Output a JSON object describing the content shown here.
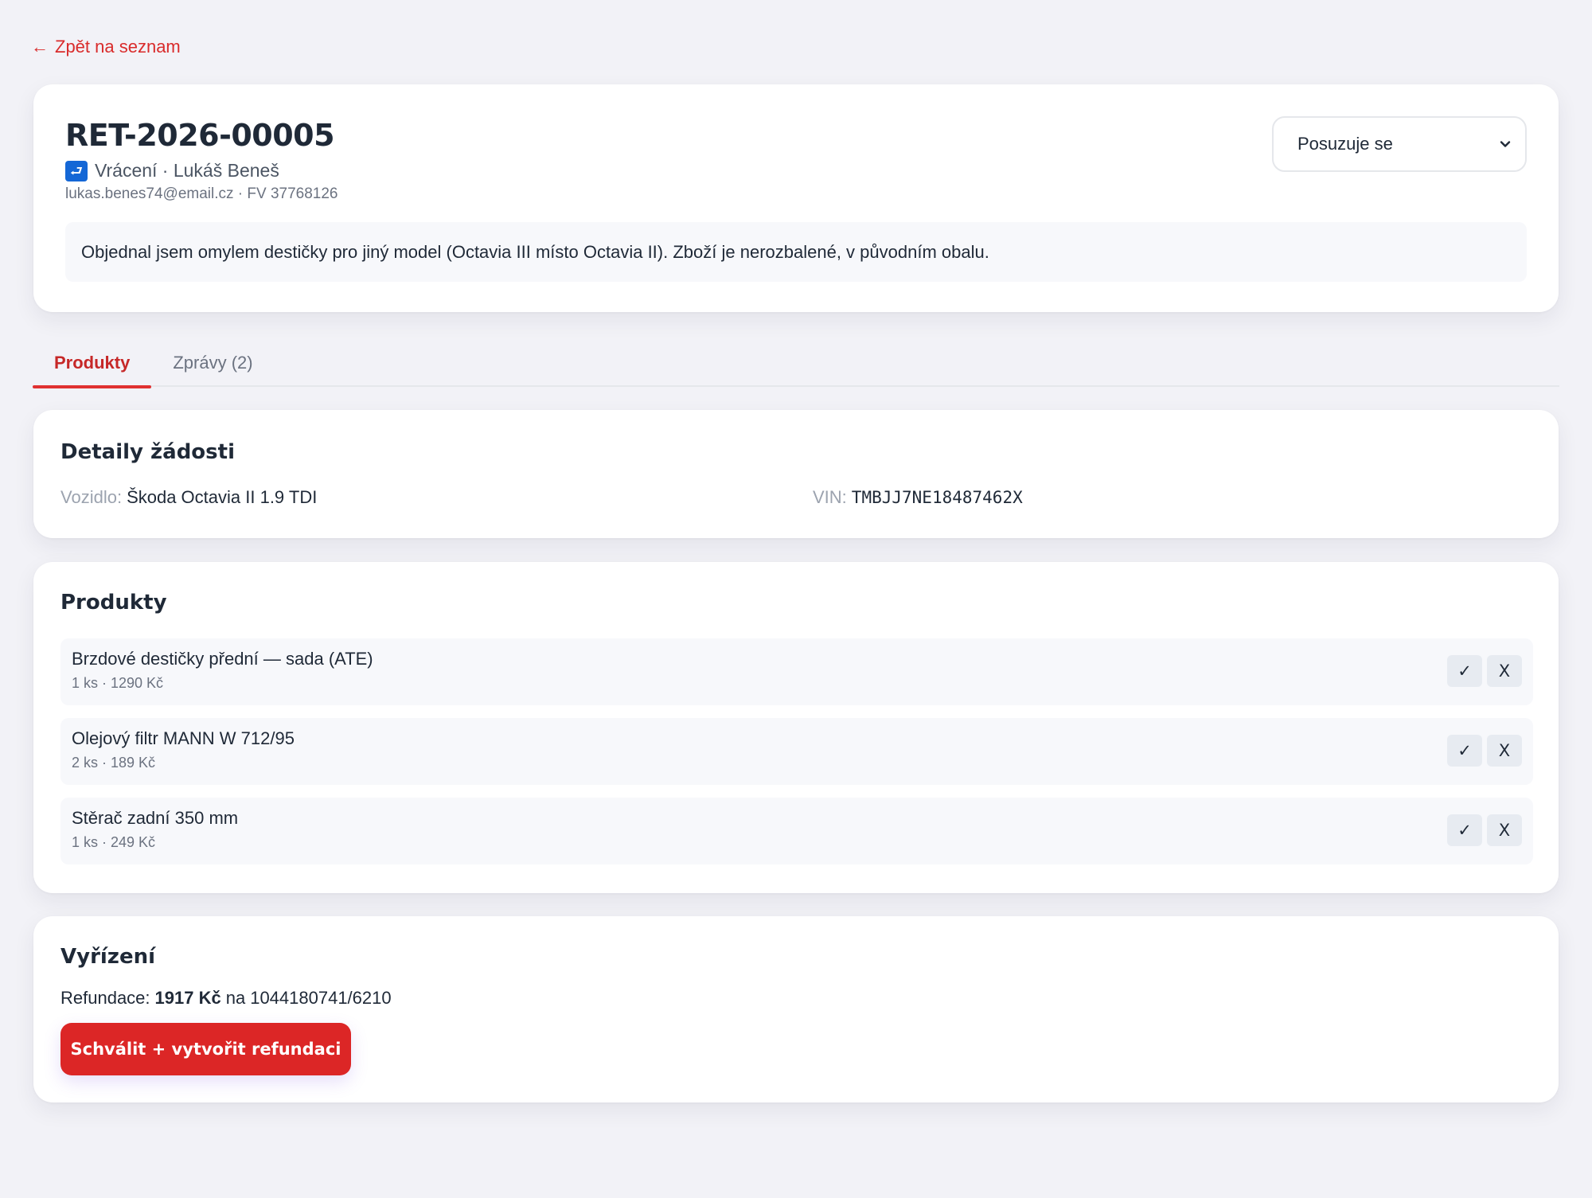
{
  "back_link": {
    "arrow": "←",
    "label": "Zpět na seznam"
  },
  "header": {
    "ticket_id": "RET-2026-00005",
    "type_icon": "return-arrow-icon",
    "type_icon_glyph": "⮐",
    "subtitle": "Vrácení · Lukáš Beneš",
    "meta": "lukas.benes74@email.cz · FV 37768126",
    "status": {
      "selected": "Posuzuje se"
    },
    "reason": "Objednal jsem omylem destičky pro jiný model (Octavia III místo Octavia II). Zboží je nerozbalené, v původním obalu."
  },
  "tabs": [
    {
      "label": "Produkty",
      "active": true
    },
    {
      "label": "Zprávy (2)",
      "active": false
    }
  ],
  "details": {
    "title": "Detaily žádosti",
    "vehicle_label": "Vozidlo:",
    "vehicle_value": "Škoda Octavia II 1.9 TDI",
    "vin_label": "VIN:",
    "vin_value": "TMBJJ7NE18487462X"
  },
  "products": {
    "title": "Produkty",
    "items": [
      {
        "name": "Brzdové destičky přední — sada (ATE)",
        "meta": "1 ks · 1290 Kč",
        "approve": "✓",
        "reject": "X"
      },
      {
        "name": "Olejový filtr MANN W 712/95",
        "meta": "2 ks · 189 Kč",
        "approve": "✓",
        "reject": "X"
      },
      {
        "name": "Stěrač zadní 350 mm",
        "meta": "1 ks · 249 Kč",
        "approve": "✓",
        "reject": "X"
      }
    ]
  },
  "resolution": {
    "title": "Vyřízení",
    "refund_label": "Refundace:",
    "refund_amount": "1917 Kč",
    "refund_connector": "na",
    "refund_account": "1044180741/6210",
    "approve_button": "Schválit + vytvořit refundaci"
  },
  "colors": {
    "accent": "#dc2626",
    "background": "#f2f2f7",
    "card": "#ffffff",
    "badge": "#1467d6"
  }
}
